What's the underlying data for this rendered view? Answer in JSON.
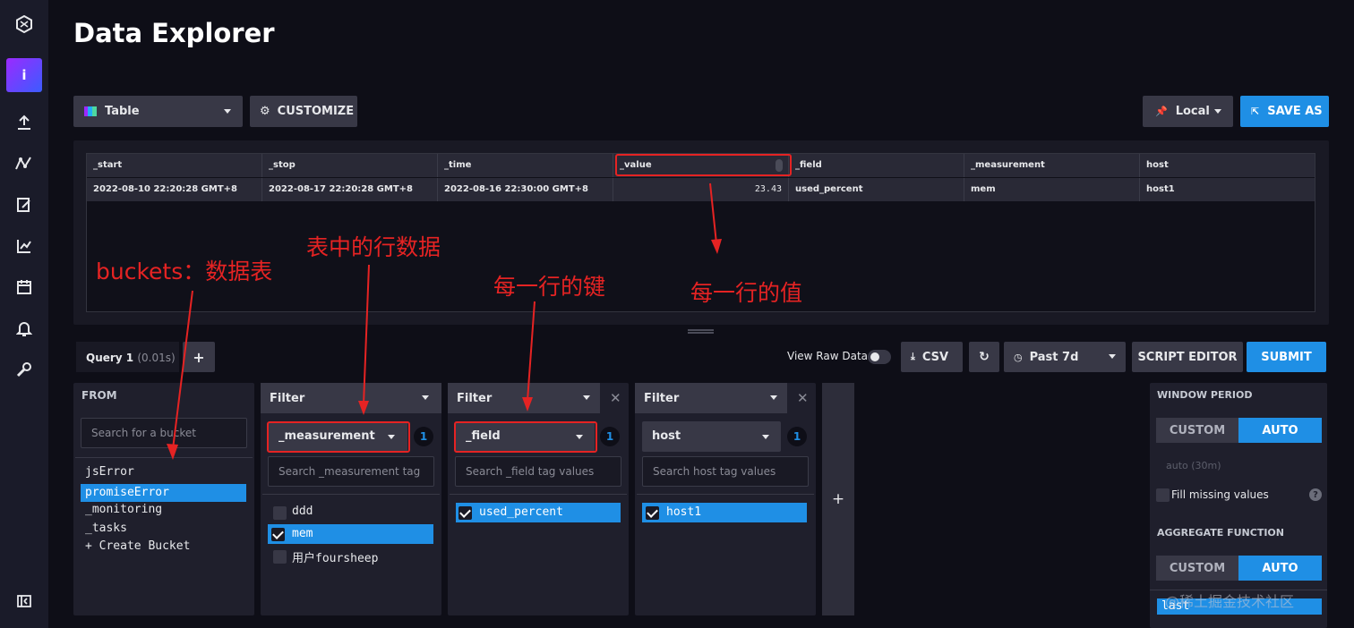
{
  "page_title": "Data Explorer",
  "sidebar": {
    "items": [
      {
        "icon": "influx-logo-icon"
      },
      {
        "icon": "user-avatar-icon",
        "label": "i"
      },
      {
        "icon": "upload-icon"
      },
      {
        "icon": "data-explorer-icon"
      },
      {
        "icon": "notebook-icon"
      },
      {
        "icon": "dashboard-icon"
      },
      {
        "icon": "calendar-icon"
      },
      {
        "icon": "bell-icon"
      },
      {
        "icon": "wrench-icon"
      },
      {
        "icon": "collapse-icon"
      }
    ]
  },
  "toolbar": {
    "viz_type": "Table",
    "customize_label": "CUSTOMIZE",
    "timezone": "Local",
    "save_as_label": "SAVE AS"
  },
  "table": {
    "columns": [
      "_start",
      "_stop",
      "_time",
      "_value",
      "_field",
      "_measurement",
      "host"
    ],
    "rows": [
      [
        "2022-08-10 22:20:28 GMT+8",
        "2022-08-17 22:20:28 GMT+8",
        "2022-08-16 22:30:00 GMT+8",
        "23.43",
        "used_percent",
        "mem",
        "host1"
      ]
    ]
  },
  "annotations": {
    "buckets": "buckets：数据表",
    "rows": "表中的行数据",
    "keys": "每一行的键",
    "values": "每一行的值"
  },
  "query_bar": {
    "tab_label": "Query 1",
    "tab_time": "(0.01s)",
    "add_label": "+",
    "raw_data_label": "View Raw Data",
    "csv_label": "CSV",
    "time_range": "Past 7d",
    "script_editor_label": "SCRIPT EDITOR",
    "submit_label": "SUBMIT"
  },
  "from_panel": {
    "header": "FROM",
    "search_placeholder": "Search for a bucket",
    "buckets": [
      "jsError",
      "promiseError",
      "_monitoring",
      "_tasks",
      "+ Create Bucket"
    ],
    "selected": "promiseError"
  },
  "filters": [
    {
      "header": "Filter",
      "key": "_measurement",
      "count": "1",
      "search_placeholder": "Search _measurement tag",
      "values": [
        {
          "label": "ddd",
          "checked": false
        },
        {
          "label": "mem",
          "checked": true
        },
        {
          "label": "用户foursheep",
          "checked": false
        }
      ]
    },
    {
      "header": "Filter",
      "key": "_field",
      "count": "1",
      "search_placeholder": "Search _field tag values",
      "values": [
        {
          "label": "used_percent",
          "checked": true
        }
      ]
    },
    {
      "header": "Filter",
      "key": "host",
      "count": "1",
      "search_placeholder": "Search host tag values",
      "values": [
        {
          "label": "host1",
          "checked": true
        }
      ]
    }
  ],
  "add_filter_label": "+",
  "window_panel": {
    "window_header": "WINDOW PERIOD",
    "custom_label": "CUSTOM",
    "auto_label": "AUTO",
    "auto_hint": "auto (30m)",
    "fill_missing_label": "Fill missing values",
    "help_label": "?",
    "aggregate_header": "AGGREGATE FUNCTION",
    "agg_custom_label": "CUSTOM",
    "agg_auto_label": "AUTO",
    "selected_fn": "last"
  },
  "watermark": "@稀土掘金技术社区",
  "colors": {
    "accent": "#1f8fe5",
    "annotation": "#e52323",
    "bg": "#0e0e17"
  }
}
